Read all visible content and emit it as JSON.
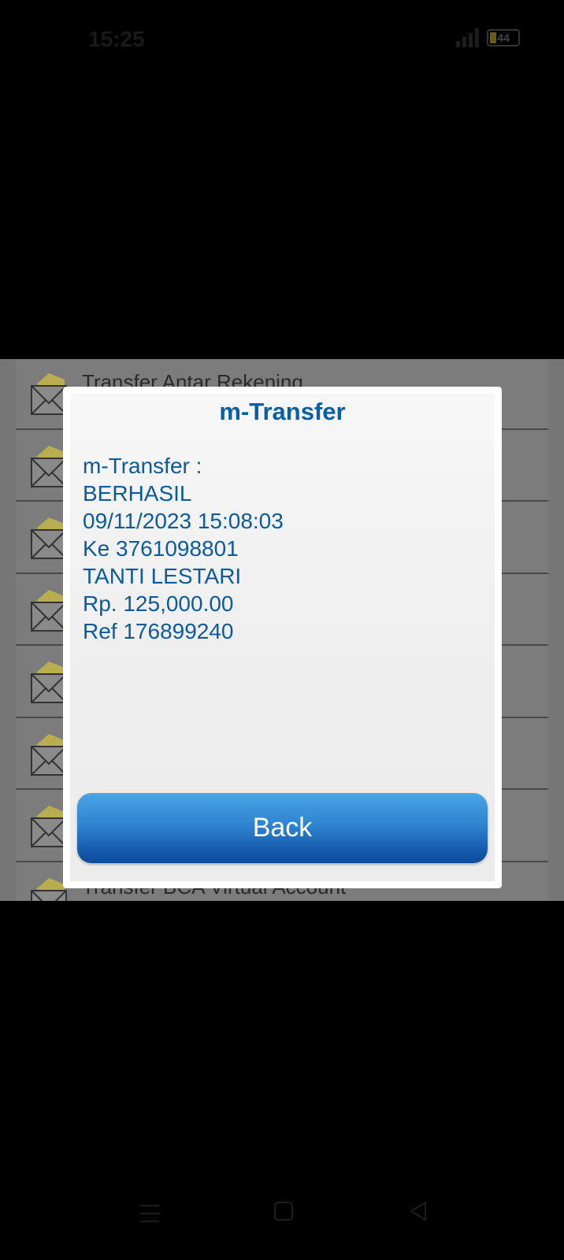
{
  "status_bar": {
    "time": "15:25",
    "battery": "44"
  },
  "menu": {
    "items": [
      {
        "label": "Transfer Antar Rekening",
        "icon": "envelope-icon"
      },
      {
        "label": "",
        "icon": "envelope-icon"
      },
      {
        "label": "",
        "icon": "envelope-icon"
      },
      {
        "label": "",
        "icon": "envelope-icon"
      },
      {
        "label": "",
        "icon": "envelope-icon"
      },
      {
        "label": "",
        "icon": "envelope-icon"
      },
      {
        "label": "",
        "icon": "envelope-icon"
      },
      {
        "label": "Transfer BCA Virtual Account",
        "icon": "envelope-icon"
      }
    ]
  },
  "dialog": {
    "title": "m-Transfer",
    "lines": [
      "m-Transfer :",
      "BERHASIL",
      "09/11/2023 15:08:03",
      "Ke 3761098801",
      "TANTI LESTARI",
      "Rp. 125,000.00",
      "Ref 176899240"
    ],
    "back_label": "Back"
  },
  "navigation": {
    "icons": [
      "menu-icon",
      "home-icon",
      "back-icon"
    ]
  },
  "colors": {
    "accent": "#0a5ea4",
    "button_top": "#4aa6e6",
    "button_bottom": "#0b4a9a"
  }
}
